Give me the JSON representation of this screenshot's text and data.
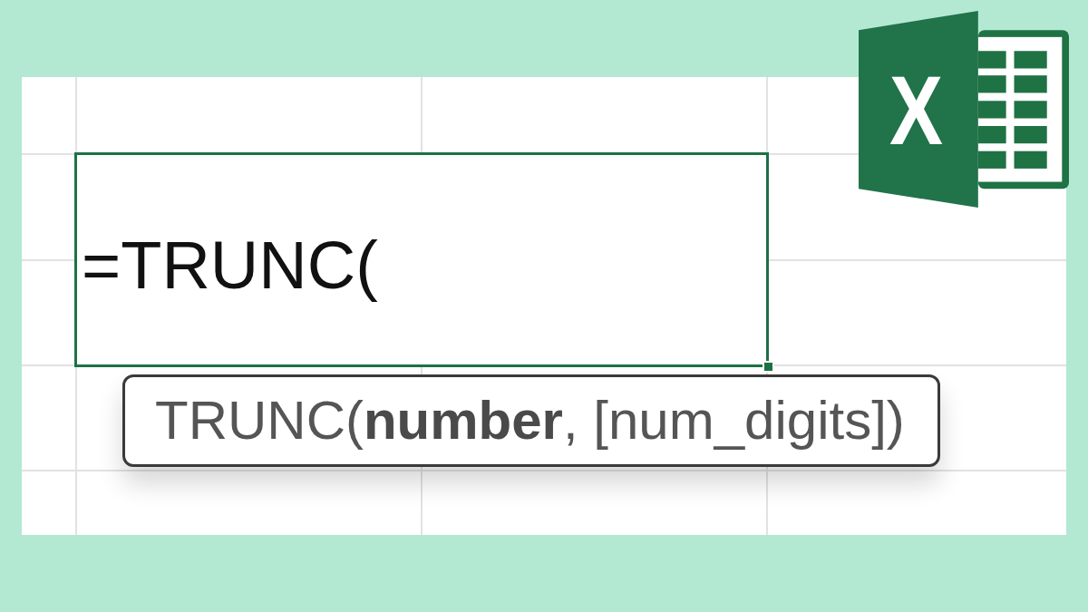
{
  "logo": {
    "letter": "X"
  },
  "sheet": {
    "active_cell": {
      "value": "=TRUNC("
    },
    "tooltip": {
      "text": "TRUNC(**number**, [num_digits])"
    }
  }
}
